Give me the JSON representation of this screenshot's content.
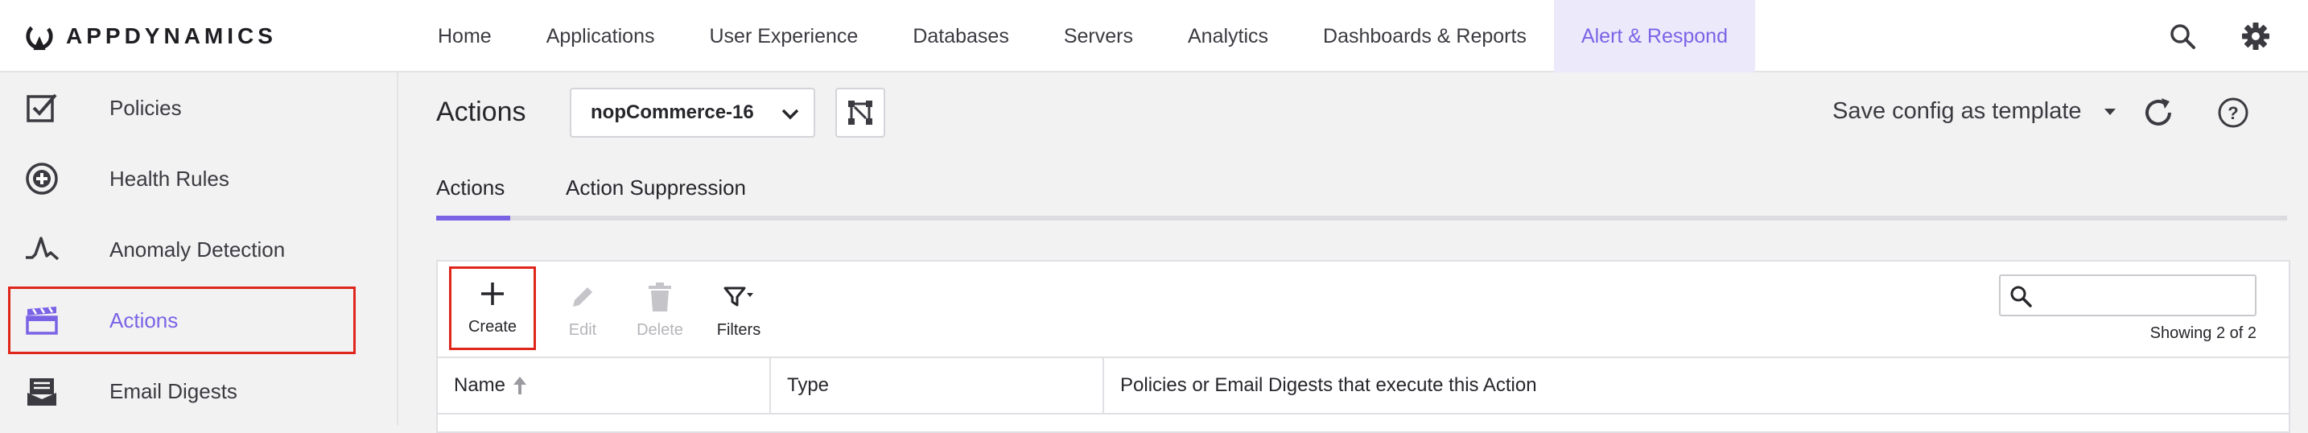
{
  "brand": {
    "name": "APPDYNAMICS"
  },
  "nav": {
    "items": [
      {
        "label": "Home"
      },
      {
        "label": "Applications"
      },
      {
        "label": "User Experience"
      },
      {
        "label": "Databases"
      },
      {
        "label": "Servers"
      },
      {
        "label": "Analytics"
      },
      {
        "label": "Dashboards & Reports"
      },
      {
        "label": "Alert & Respond",
        "active": true
      }
    ],
    "icons": [
      "search-icon",
      "gear-icon"
    ]
  },
  "sidebar": {
    "items": [
      {
        "label": "Policies",
        "icon": "checkbox-icon"
      },
      {
        "label": "Health Rules",
        "icon": "plus-circle-icon"
      },
      {
        "label": "Anomaly Detection",
        "icon": "anomaly-icon"
      },
      {
        "label": "Actions",
        "icon": "clapperboard-icon",
        "active": true
      },
      {
        "label": "Email Digests",
        "icon": "email-digest-icon"
      }
    ]
  },
  "header": {
    "title": "Actions",
    "application": "nopCommerce-16",
    "save_template": "Save config as template"
  },
  "tabs": [
    {
      "label": "Actions",
      "active": true
    },
    {
      "label": "Action Suppression"
    }
  ],
  "toolbar": {
    "create": "Create",
    "edit": "Edit",
    "delete": "Delete",
    "filters": "Filters"
  },
  "search": {
    "placeholder": "",
    "value": ""
  },
  "showing": "Showing 2 of 2",
  "table": {
    "columns": [
      "Name",
      "Type",
      "Policies or Email Digests that execute this Action"
    ],
    "rows": []
  },
  "colors": {
    "accent": "#7b63e6",
    "highlight": "#e0261b"
  }
}
